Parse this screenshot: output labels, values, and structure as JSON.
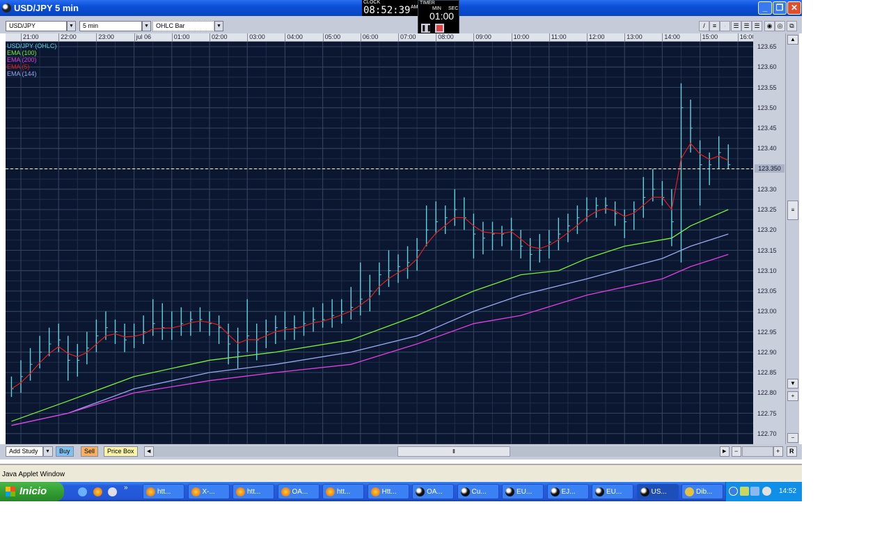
{
  "window": {
    "title": "USD/JPY   5 min",
    "minimize": "_",
    "maximize": "❐",
    "close": "✕"
  },
  "clock": {
    "label": "CLOCK",
    "time": "08:52:39",
    "ampm": "AM"
  },
  "timer": {
    "label": "TIMER",
    "min_label": "MIN",
    "sec_label": "SEC",
    "value": "01:00"
  },
  "toolbar": {
    "symbol": "USD/JPY",
    "interval": "5 min",
    "chart_type": "OHLC Bar"
  },
  "legend": [
    {
      "label": "USD/JPY (OHLC)",
      "color": "#5fd3e0"
    },
    {
      "label": "EMA (100)",
      "color": "#7cf03c"
    },
    {
      "label": "EMA (200)",
      "color": "#e040e0"
    },
    {
      "label": "EMA (5)",
      "color": "#e02020"
    },
    {
      "label": "EMA (144)",
      "color": "#9aa8f0"
    }
  ],
  "bottombar": {
    "add_study": "Add Study",
    "buy": "Buy",
    "sell": "Sell",
    "price_box": "Price Box",
    "reset": "R"
  },
  "status": "Java Applet Window",
  "taskbar": {
    "start": "Inicio",
    "tasks": [
      {
        "label": "htt...",
        "icon": "firefox"
      },
      {
        "label": "X-...",
        "icon": "firefox"
      },
      {
        "label": "htt...",
        "icon": "firefox"
      },
      {
        "label": "OA...",
        "icon": "firefox"
      },
      {
        "label": "htt...",
        "icon": "firefox"
      },
      {
        "label": "Htt...",
        "icon": "firefox"
      },
      {
        "label": "OA...",
        "icon": "java"
      },
      {
        "label": "Cu...",
        "icon": "java"
      },
      {
        "label": "EU...",
        "icon": "java"
      },
      {
        "label": "EJ...",
        "icon": "java"
      },
      {
        "label": "EU...",
        "icon": "java"
      },
      {
        "label": "US...",
        "icon": "java",
        "active": true
      },
      {
        "label": "Dib...",
        "icon": "paint"
      }
    ],
    "clock": "14:52"
  },
  "chart_data": {
    "type": "ohlc",
    "symbol": "USD/JPY",
    "interval": "5 min",
    "x_tick_labels": [
      "21:00",
      "22:00",
      "23:00",
      "jul 06",
      "01:00",
      "02:00",
      "03:00",
      "04:00",
      "05:00",
      "06:00",
      "07:00",
      "08:00",
      "09:00",
      "10:00",
      "11:00",
      "12:00",
      "13:00",
      "14:00",
      "15:00",
      "16:00"
    ],
    "y_tick_labels": [
      "123.65",
      "123.60",
      "123.55",
      "123.50",
      "123.45",
      "123.40",
      "123.30",
      "123.25",
      "123.20",
      "123.15",
      "123.10",
      "123.05",
      "123.00",
      "122.95",
      "122.90",
      "122.85",
      "122.80",
      "122.75",
      "122.70"
    ],
    "ylim": [
      122.68,
      123.66
    ],
    "current_price": "123.350",
    "grid": true,
    "bar_start_time": "20:45",
    "bar_step_minutes": 15,
    "bars_hlc": [
      [
        122.84,
        122.79,
        122.81
      ],
      [
        122.88,
        122.8,
        122.84
      ],
      [
        122.91,
        122.83,
        122.87
      ],
      [
        122.94,
        122.86,
        122.9
      ],
      [
        122.96,
        122.89,
        122.92
      ],
      [
        122.97,
        122.9,
        122.93
      ],
      [
        122.94,
        122.83,
        122.88
      ],
      [
        122.92,
        122.84,
        122.88
      ],
      [
        122.95,
        122.87,
        122.91
      ],
      [
        122.98,
        122.9,
        122.94
      ],
      [
        123.0,
        122.93,
        122.96
      ],
      [
        122.98,
        122.92,
        122.95
      ],
      [
        122.97,
        122.9,
        122.93
      ],
      [
        122.97,
        122.91,
        122.94
      ],
      [
        122.99,
        122.92,
        122.95
      ],
      [
        123.03,
        122.94,
        122.97
      ],
      [
        123.02,
        122.93,
        122.96
      ],
      [
        123.0,
        122.93,
        122.96
      ],
      [
        123.01,
        122.94,
        122.97
      ],
      [
        123.0,
        122.94,
        122.98
      ],
      [
        123.01,
        122.95,
        122.98
      ],
      [
        123.0,
        122.94,
        122.97
      ],
      [
        122.99,
        122.92,
        122.96
      ],
      [
        122.97,
        122.87,
        122.92
      ],
      [
        122.96,
        122.86,
        122.9
      ],
      [
        123.03,
        122.9,
        122.94
      ],
      [
        122.97,
        122.88,
        122.93
      ],
      [
        122.98,
        122.91,
        122.95
      ],
      [
        122.99,
        122.92,
        122.96
      ],
      [
        123.0,
        122.93,
        122.96
      ],
      [
        122.99,
        122.93,
        122.96
      ],
      [
        123.0,
        122.94,
        122.97
      ],
      [
        123.01,
        122.95,
        122.98
      ],
      [
        123.02,
        122.96,
        122.98
      ],
      [
        123.03,
        122.96,
        122.99
      ],
      [
        123.03,
        122.97,
        123.0
      ],
      [
        123.06,
        122.98,
        123.01
      ],
      [
        123.12,
        122.99,
        123.03
      ],
      [
        123.09,
        123.0,
        123.05
      ],
      [
        123.12,
        123.04,
        123.09
      ],
      [
        123.15,
        123.06,
        123.1
      ],
      [
        123.14,
        123.07,
        123.11
      ],
      [
        123.16,
        123.08,
        123.12
      ],
      [
        123.18,
        123.1,
        123.15
      ],
      [
        123.26,
        123.16,
        123.2
      ],
      [
        123.27,
        123.19,
        123.22
      ],
      [
        123.26,
        123.19,
        123.23
      ],
      [
        123.3,
        123.21,
        123.25
      ],
      [
        123.28,
        123.2,
        123.23
      ],
      [
        123.24,
        123.13,
        123.19
      ],
      [
        123.22,
        123.14,
        123.18
      ],
      [
        123.22,
        123.15,
        123.19
      ],
      [
        123.21,
        123.16,
        123.19
      ],
      [
        123.23,
        123.15,
        123.2
      ],
      [
        123.2,
        123.13,
        123.16
      ],
      [
        123.18,
        123.1,
        123.14
      ],
      [
        123.19,
        123.12,
        123.15
      ],
      [
        123.2,
        123.13,
        123.17
      ],
      [
        123.23,
        123.15,
        123.19
      ],
      [
        123.24,
        123.17,
        123.21
      ],
      [
        123.26,
        123.19,
        123.23
      ],
      [
        123.28,
        123.22,
        123.25
      ],
      [
        123.28,
        123.23,
        123.26
      ],
      [
        123.28,
        123.24,
        123.26
      ],
      [
        123.27,
        123.21,
        123.24
      ],
      [
        123.25,
        123.18,
        123.22
      ],
      [
        123.27,
        123.2,
        123.25
      ],
      [
        123.33,
        123.23,
        123.28
      ],
      [
        123.35,
        123.27,
        123.3
      ],
      [
        123.32,
        123.26,
        123.28
      ],
      [
        123.3,
        123.16,
        123.22
      ],
      [
        123.56,
        123.12,
        123.5
      ],
      [
        123.52,
        123.39,
        123.45
      ],
      [
        123.42,
        123.26,
        123.36
      ],
      [
        123.39,
        123.31,
        123.36
      ],
      [
        123.43,
        123.35,
        123.39
      ],
      [
        123.41,
        123.35,
        123.36
      ]
    ],
    "series": [
      {
        "name": "EMA (100)",
        "color": "#7cf03c",
        "points": [
          [
            "20:45",
            122.73
          ],
          [
            "22:15",
            122.78
          ],
          [
            "00:00",
            122.84
          ],
          [
            "02:00",
            122.88
          ],
          [
            "03:45",
            122.9
          ],
          [
            "05:45",
            122.93
          ],
          [
            "07:30",
            122.99
          ],
          [
            "09:00",
            123.05
          ],
          [
            "10:15",
            123.09
          ],
          [
            "11:15",
            123.1
          ],
          [
            "12:00",
            123.13
          ],
          [
            "13:00",
            123.16
          ],
          [
            "14:15",
            123.18
          ],
          [
            "14:45",
            123.21
          ],
          [
            "15:45",
            123.25
          ]
        ]
      },
      {
        "name": "EMA (144)",
        "color": "#9aa8f0",
        "points": [
          [
            "20:45",
            122.72
          ],
          [
            "22:15",
            122.75
          ],
          [
            "00:00",
            122.81
          ],
          [
            "02:00",
            122.85
          ],
          [
            "03:45",
            122.87
          ],
          [
            "05:45",
            122.9
          ],
          [
            "07:30",
            122.94
          ],
          [
            "09:00",
            123.0
          ],
          [
            "10:15",
            123.04
          ],
          [
            "12:00",
            123.08
          ],
          [
            "14:00",
            123.13
          ],
          [
            "14:45",
            123.16
          ],
          [
            "15:45",
            123.19
          ]
        ]
      },
      {
        "name": "EMA (200)",
        "color": "#e040e0",
        "points": [
          [
            "20:45",
            122.72
          ],
          [
            "22:15",
            122.75
          ],
          [
            "00:00",
            122.8
          ],
          [
            "02:00",
            122.83
          ],
          [
            "03:45",
            122.85
          ],
          [
            "05:45",
            122.87
          ],
          [
            "07:30",
            122.92
          ],
          [
            "09:00",
            122.97
          ],
          [
            "10:15",
            122.99
          ],
          [
            "12:00",
            123.04
          ],
          [
            "14:00",
            123.08
          ],
          [
            "14:45",
            123.11
          ],
          [
            "15:45",
            123.14
          ]
        ]
      }
    ]
  }
}
